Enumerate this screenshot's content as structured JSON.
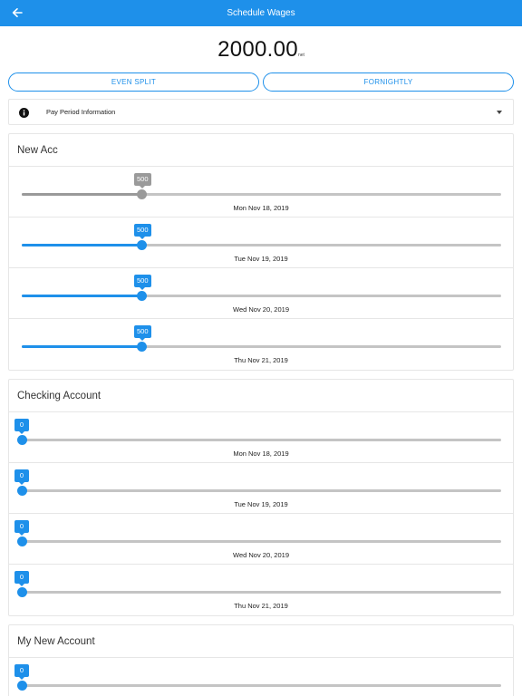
{
  "header": {
    "title": "Schedule Wages",
    "back_icon": "arrow-left-icon"
  },
  "amount": {
    "value": "2000.00",
    "suffix": "net"
  },
  "split_buttons": {
    "even_split": "EVEN SPLIT",
    "frequency": "FORNIGHTLY"
  },
  "info": {
    "label": "Pay Period Information",
    "icon": "info-icon",
    "expand_icon": "chevron-down-icon"
  },
  "colors": {
    "accent": "#1e90ea",
    "inactive": "#9a9a9a",
    "track": "#c4c4c4"
  },
  "slider_max": 2000,
  "accounts": [
    {
      "name": "New Acc",
      "rows": [
        {
          "date": "Mon Nov 18, 2019",
          "value": 500,
          "label": "500",
          "active": false
        },
        {
          "date": "Tue Nov 19, 2019",
          "value": 500,
          "label": "500",
          "active": true
        },
        {
          "date": "Wed Nov 20, 2019",
          "value": 500,
          "label": "500",
          "active": true
        },
        {
          "date": "Thu Nov 21, 2019",
          "value": 500,
          "label": "500",
          "active": true
        }
      ]
    },
    {
      "name": "Checking Account",
      "rows": [
        {
          "date": "Mon Nov 18, 2019",
          "value": 0,
          "label": "0",
          "active": true
        },
        {
          "date": "Tue Nov 19, 2019",
          "value": 0,
          "label": "0",
          "active": true
        },
        {
          "date": "Wed Nov 20, 2019",
          "value": 0,
          "label": "0",
          "active": true
        },
        {
          "date": "Thu Nov 21, 2019",
          "value": 0,
          "label": "0",
          "active": true
        }
      ]
    },
    {
      "name": "My New Account",
      "rows": [
        {
          "date": "",
          "value": 0,
          "label": "0",
          "active": true
        }
      ]
    }
  ]
}
